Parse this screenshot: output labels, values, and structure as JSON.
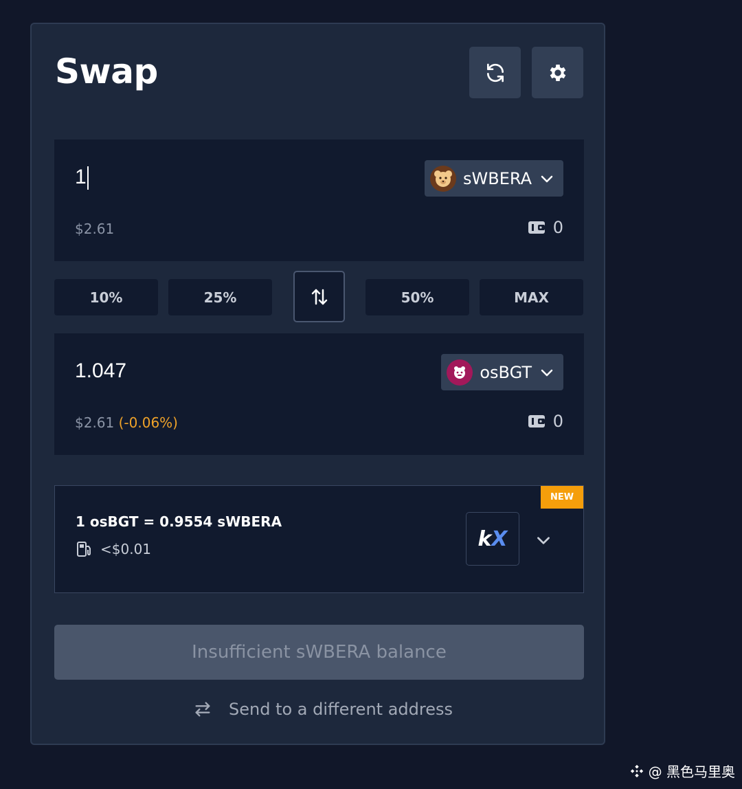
{
  "header": {
    "title": "Swap",
    "refresh_icon": "refresh-icon",
    "settings_icon": "gear-icon"
  },
  "from": {
    "amount": "1",
    "token": "sWBERA",
    "usd_value": "$2.61",
    "balance": "0"
  },
  "percent_buttons": [
    "10%",
    "25%",
    "50%",
    "MAX"
  ],
  "to": {
    "amount": "1.047",
    "token": "osBGT",
    "usd_value": "$2.61",
    "usd_delta": "(-0.06%)",
    "balance": "0"
  },
  "route": {
    "badge": "NEW",
    "rate": "1 osBGT = 0.9554 sWBERA",
    "gas": "<$0.01",
    "aggregator_logo_k": "k",
    "aggregator_logo_x": "X"
  },
  "cta_label": "Insufficient sWBERA balance",
  "send_link": "Send to a different address",
  "watermark": "@ 黑色马里奥",
  "colors": {
    "background": "#111729",
    "card": "#1d283c",
    "panel": "#111a2e",
    "badge": "#f59e0b",
    "delta": "#f0a329"
  }
}
